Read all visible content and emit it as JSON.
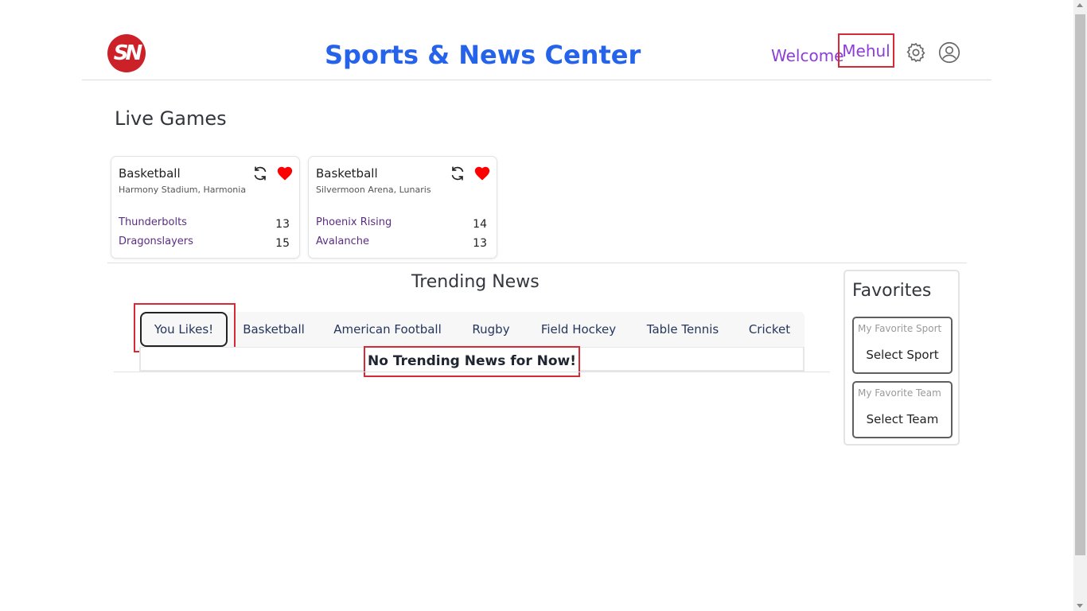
{
  "header": {
    "logo_text": "SN",
    "title": "Sports & News Center",
    "welcome_label": "Welcome",
    "username": "Mehul"
  },
  "live_games": {
    "heading": "Live Games",
    "games": [
      {
        "sport": "Basketball",
        "venue": "Harmony Stadium, Harmonia",
        "teams": [
          {
            "name": "Thunderbolts",
            "score": "13"
          },
          {
            "name": "Dragonslayers",
            "score": "15"
          }
        ]
      },
      {
        "sport": "Basketball",
        "venue": "Silvermoon Arena, Lunaris",
        "teams": [
          {
            "name": "Phoenix Rising",
            "score": "14"
          },
          {
            "name": "Avalanche",
            "score": "13"
          }
        ]
      }
    ]
  },
  "trending": {
    "heading": "Trending News",
    "tabs": [
      "You Likes!",
      "Basketball",
      "American Football",
      "Rugby",
      "Field Hockey",
      "Table Tennis",
      "Cricket"
    ],
    "active_tab": "You Likes!",
    "empty_message": "No Trending News for Now!"
  },
  "favorites": {
    "heading": "Favorites",
    "sport_caption": "My Favorite Sport",
    "sport_value": "Select Sport",
    "team_caption": "My Favorite Team",
    "team_value": "Select Team"
  },
  "icons": {
    "logo": "sn-logo",
    "settings": "gear-icon",
    "account": "user-circle-icon",
    "refresh": "refresh-icon",
    "favorite": "heart-icon"
  },
  "colors": {
    "brand_red": "#cc2128",
    "title_blue": "#2563eb",
    "welcome_purple": "#8b3fd6",
    "heart_red": "#ff0000",
    "highlight_red": "#d62a35"
  }
}
